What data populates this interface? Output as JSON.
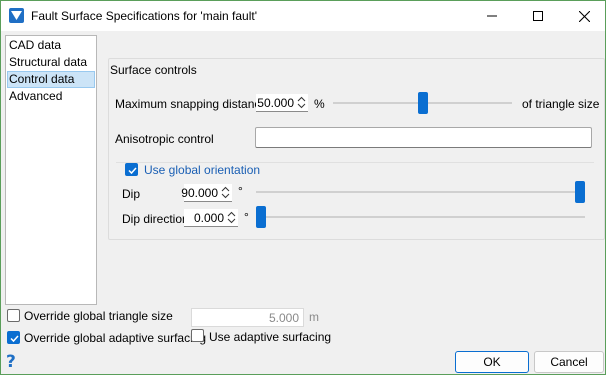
{
  "window": {
    "title": "Fault Surface Specifications for 'main fault'",
    "controls": [
      "minimize-icon",
      "maximize-icon",
      "close-icon"
    ]
  },
  "nav": {
    "items": [
      {
        "label": "CAD data",
        "selected": false
      },
      {
        "label": "Structural data",
        "selected": false
      },
      {
        "label": "Control data",
        "selected": true
      },
      {
        "label": "Advanced",
        "selected": false
      }
    ]
  },
  "surface_controls": {
    "group_label": "Surface controls",
    "snapping": {
      "label": "Maximum snapping distance",
      "value": "50.000",
      "unit": "%",
      "suffix": "of triangle size",
      "slider_fraction": 0.5
    },
    "anisotropic": {
      "label": "Anisotropic control",
      "value": ""
    },
    "global_orientation": {
      "label": "Use global orientation",
      "checked": true
    },
    "dip": {
      "label": "Dip",
      "value": "90.000",
      "unit": "°",
      "slider_fraction": 1.0
    },
    "dip_direction": {
      "label": "Dip direction",
      "value": "0.000",
      "unit": "°",
      "slider_fraction": 0.0
    }
  },
  "bottom": {
    "override_triangle": {
      "label": "Override global triangle size",
      "checked": false,
      "value": "5.000",
      "unit": "m"
    },
    "override_adaptive": {
      "label": "Override global adaptive surfacing",
      "checked": true
    },
    "use_adaptive": {
      "label": "Use adaptive surfacing",
      "checked": false
    },
    "help_glyph": "?",
    "ok_label": "OK",
    "cancel_label": "Cancel"
  },
  "colors": {
    "accent": "#0a6ed1",
    "selection": "#cce4f7",
    "window_border": "#5a9e5a",
    "link_blue": "#1a5fb4"
  }
}
